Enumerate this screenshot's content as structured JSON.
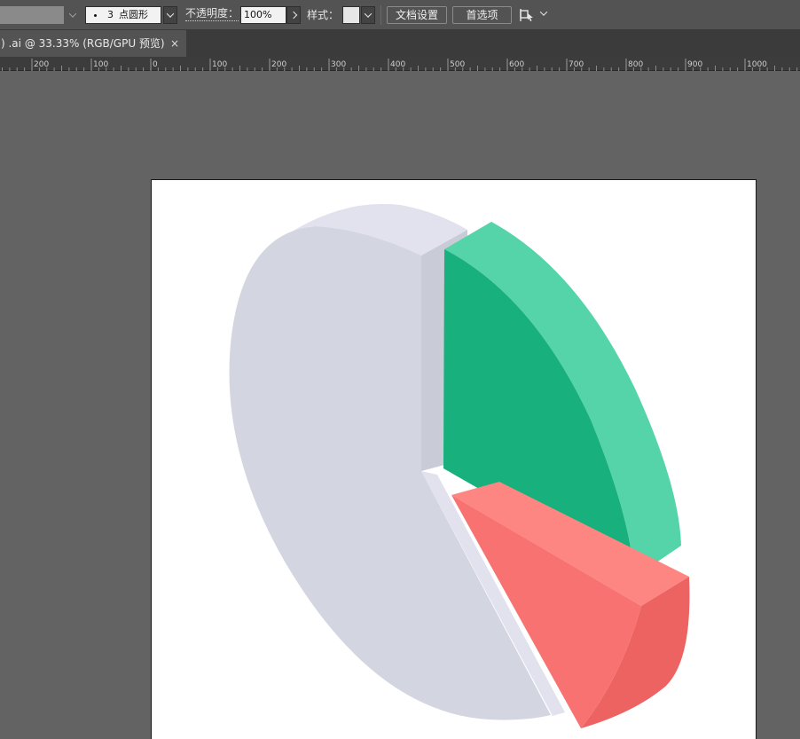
{
  "control_bar": {
    "brush_size": "3",
    "brush_shape": "点圆形",
    "opacity_label": "不透明度：",
    "opacity_value": "100%",
    "style_label": "样式：",
    "doc_setup_button": "文档设置",
    "preferences_button": "首选项",
    "icons": [
      "chevron-down-icon",
      "chevron-right-icon",
      "arrange-icon"
    ]
  },
  "tab": {
    "title": ") .ai @ 33.33% (RGB/GPU 预览)",
    "close": "×"
  },
  "ruler": {
    "ticks": [
      {
        "value": 200,
        "label": "200"
      },
      {
        "value": 100,
        "label": "100"
      },
      {
        "value": 0,
        "label": "0"
      },
      {
        "value": 100,
        "label": "100"
      },
      {
        "value": 200,
        "label": "200"
      },
      {
        "value": 300,
        "label": "300"
      },
      {
        "value": 400,
        "label": "400"
      },
      {
        "value": 500,
        "label": "500"
      },
      {
        "value": 600,
        "label": "600"
      },
      {
        "value": 700,
        "label": "700"
      },
      {
        "value": 800,
        "label": "800"
      },
      {
        "value": 900,
        "label": "900"
      },
      {
        "value": 1000,
        "label": "1000"
      }
    ]
  },
  "artwork": {
    "colors": {
      "gray_face": "#d3d6e1",
      "gray_light": "#e1e2ee",
      "gray_side": "#c9ccd7",
      "green_face": "#18b07c",
      "green_side": "#54d4a8",
      "red_face": "#f77270",
      "red_top": "#fd8683",
      "red_side": "#ec6362"
    }
  }
}
